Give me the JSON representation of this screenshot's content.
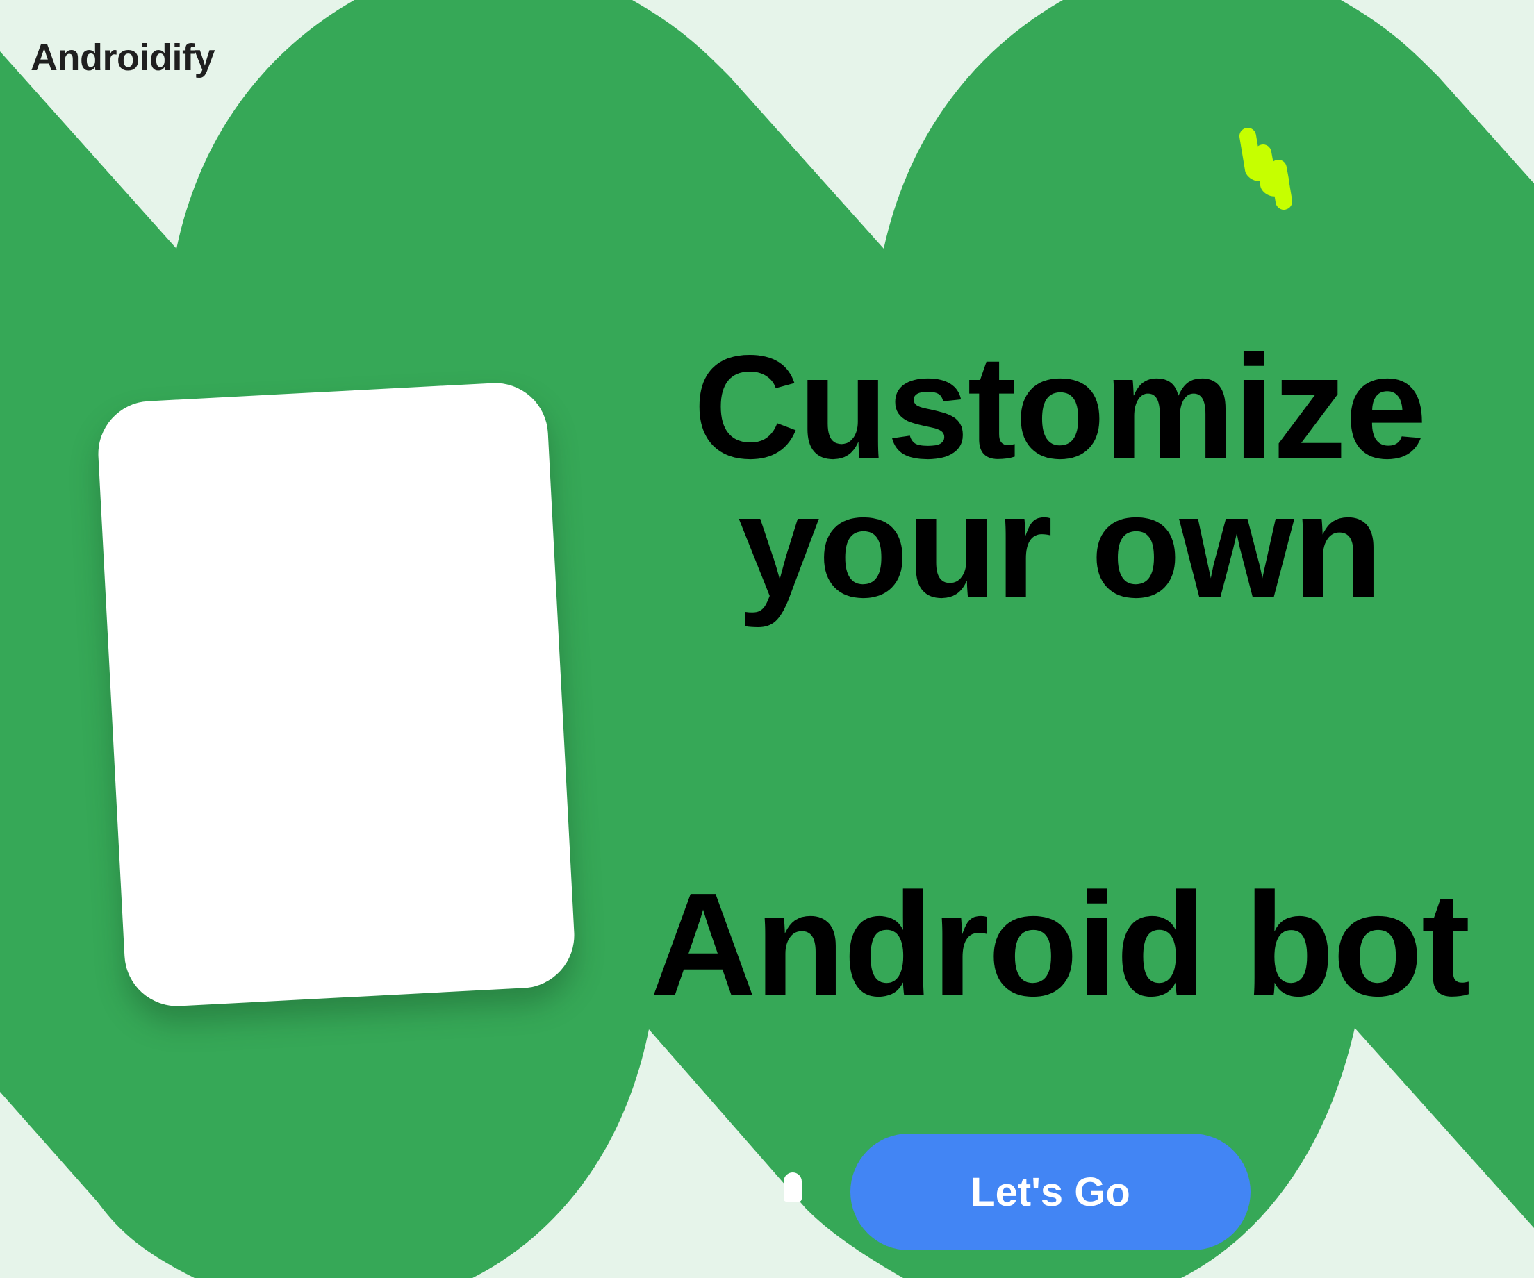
{
  "app": {
    "title": "Androidify"
  },
  "hero": {
    "headline_line1": "Customize",
    "headline_line2": "your own",
    "headline_line3": "Android bot"
  },
  "cta": {
    "label": "Let's Go"
  },
  "colors": {
    "background": "#e6f4ea",
    "brand_green": "#36a857",
    "accent_lime": "#c6ff00",
    "button_blue": "#4285f4",
    "card_white": "#ffffff",
    "text_dark": "#000000"
  },
  "icons": {
    "decoration": "squiggle-icon",
    "pager": "pager-indicator-icon"
  }
}
